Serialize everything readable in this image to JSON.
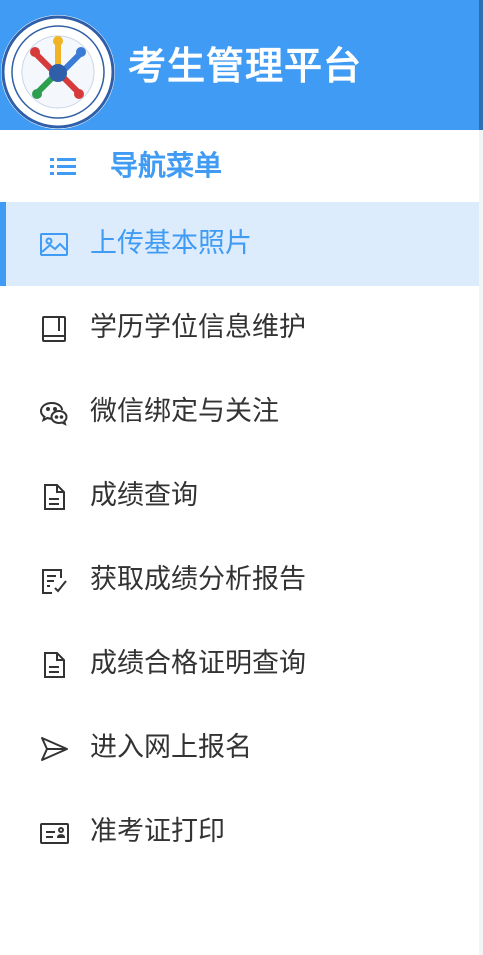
{
  "header": {
    "title": "考生管理平台",
    "background_color": "#3f9bf3",
    "logo_icon": "circular-emblem-logo"
  },
  "nav": {
    "title": "导航菜单",
    "icon": "list-icon",
    "accent_color": "#3f9bf3"
  },
  "menu": {
    "items": [
      {
        "label": "上传基本照片",
        "icon": "image-icon",
        "active": true
      },
      {
        "label": "学历学位信息维护",
        "icon": "book-icon",
        "active": false
      },
      {
        "label": "微信绑定与关注",
        "icon": "wechat-icon",
        "active": false
      },
      {
        "label": "成绩查询",
        "icon": "document-icon",
        "active": false
      },
      {
        "label": "获取成绩分析报告",
        "icon": "edit-document-icon",
        "active": false
      },
      {
        "label": "成绩合格证明查询",
        "icon": "document-icon",
        "active": false
      },
      {
        "label": "进入网上报名",
        "icon": "send-icon",
        "active": false
      },
      {
        "label": "准考证打印",
        "icon": "id-card-icon",
        "active": false
      }
    ]
  }
}
